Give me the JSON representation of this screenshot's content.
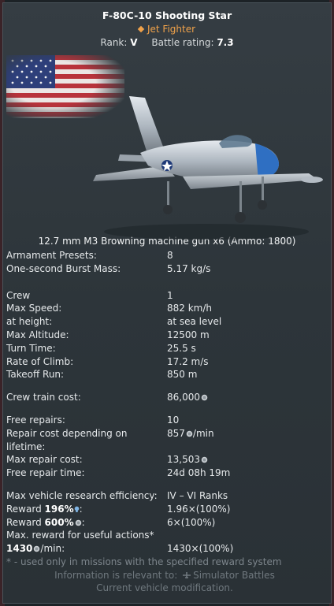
{
  "header": {
    "title": "F-80C-10 Shooting Star",
    "type": "Jet Fighter",
    "rank_label": "Rank:",
    "rank_value": "V",
    "br_label": "Battle rating:",
    "br_value": "7.3"
  },
  "weapon": "12.7 mm M3 Browning machine gun x6 (Ammo: 1800)",
  "stats": {
    "armament_presets": {
      "label": "Armament Presets:",
      "value": "8"
    },
    "burst_mass": {
      "label": "One-second Burst Mass:",
      "value": "5.17 kg/s"
    },
    "crew": {
      "label": "Crew",
      "value": "1"
    },
    "max_speed": {
      "label": "Max Speed:",
      "value": "882 km/h"
    },
    "at_height": {
      "label": "at height:",
      "value": "at sea level"
    },
    "max_altitude": {
      "label": "Max Altitude:",
      "value": "12500 m"
    },
    "turn_time": {
      "label": "Turn Time:",
      "value": "25.5 s"
    },
    "rate_of_climb": {
      "label": "Rate of Climb:",
      "value": "17.2 m/s"
    },
    "takeoff_run": {
      "label": "Takeoff Run:",
      "value": "850 m"
    },
    "crew_train_cost": {
      "label": "Crew train cost:",
      "value": "86,000"
    },
    "free_repairs": {
      "label": "Free repairs:",
      "value": "10"
    },
    "repair_cost": {
      "label_line1": "Repair cost depending on",
      "label_line2": "lifetime:",
      "value": "857",
      "unit": "/min"
    },
    "max_repair_cost": {
      "label": "Max repair cost:",
      "value": "13,503"
    },
    "free_repair_time": {
      "label": "Free repair time:",
      "value": "24d 08h 19m"
    },
    "research_eff": {
      "label": "Max vehicle research efficiency:",
      "value": "IV – VI Ranks"
    },
    "reward_rp": {
      "label_prefix": "Reward",
      "percent": "196%",
      "value": "1.96×(100%)"
    },
    "reward_sl": {
      "label_prefix": "Reward",
      "percent": "600%",
      "value": "6×(100%)"
    },
    "max_reward": {
      "label": "Max. reward for useful actions*",
      "amount": "1430",
      "unit": "/min:",
      "value": "1430×(100%)"
    }
  },
  "footnote": "* - used only in missions with the specified reward system",
  "info": {
    "line1_prefix": "Information is relevant to:",
    "line1_mode": "Simulator Battles",
    "line2": "Current vehicle modification."
  },
  "colors": {
    "accent_orange": "#f0a24a",
    "panel": "#2f373c",
    "muted": "#6f787e"
  },
  "icons": [
    "silver-lions-icon",
    "research-bulb-icon",
    "simulator-mode-icon",
    "us-flag"
  ]
}
